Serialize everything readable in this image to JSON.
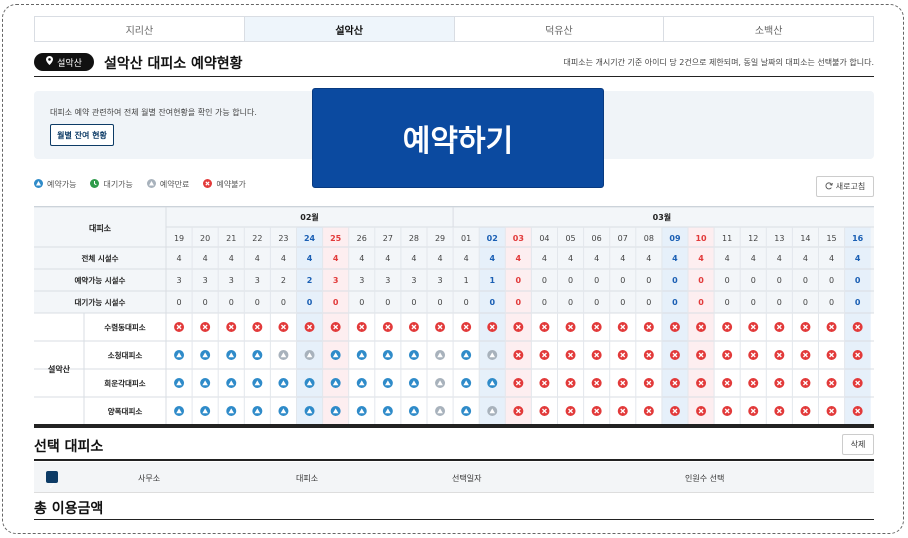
{
  "tabs": [
    {
      "label": "지리산",
      "active": false
    },
    {
      "label": "설악산",
      "active": true
    },
    {
      "label": "덕유산",
      "active": false
    },
    {
      "label": "소백산",
      "active": false
    }
  ],
  "header": {
    "region_pill": "설악산",
    "title": "설악산 대피소 예약현황",
    "note": "대피소는 개시기간 기준 아이디 당 2건으로 제한되며, 동일 날짜의 대피소는 선택불가 합니다."
  },
  "info": {
    "text": "대피소 예약 관련하여 전체 월별 잔여현황을 확인 가능 합니다.",
    "monthly_button": "월별 잔여 현황",
    "reserve_button": "예약하기"
  },
  "legend": [
    {
      "label": "예약가능",
      "status": "available"
    },
    {
      "label": "대기가능",
      "status": "waitlist"
    },
    {
      "label": "예약만료",
      "status": "expired"
    },
    {
      "label": "예약불가",
      "status": "unavailable"
    }
  ],
  "refresh_button": "새로고침",
  "colors": {
    "available": "#2f8bc9",
    "waitlist": "#2e9b4a",
    "expired": "#a8b2bc",
    "unavailable": "#e23a3a",
    "highlight_blue": "#1a5fb4",
    "highlight_red": "#e23a3a"
  },
  "table": {
    "corner_label": "대피소",
    "months": [
      {
        "label": "02월",
        "span": 11
      },
      {
        "label": "03월",
        "span": 16
      }
    ],
    "days": [
      "19",
      "20",
      "21",
      "22",
      "23",
      "24",
      "25",
      "26",
      "27",
      "28",
      "29",
      "01",
      "02",
      "03",
      "04",
      "05",
      "06",
      "07",
      "08",
      "09",
      "10",
      "11",
      "12",
      "13",
      "14",
      "15",
      "16"
    ],
    "day_types": [
      "n",
      "n",
      "n",
      "n",
      "n",
      "sat",
      "sun",
      "n",
      "n",
      "n",
      "n",
      "n",
      "sat",
      "sun",
      "n",
      "n",
      "n",
      "n",
      "n",
      "sat",
      "sun",
      "n",
      "n",
      "n",
      "n",
      "n",
      "sat"
    ],
    "summary_rows": [
      {
        "label": "전체 시설수",
        "values": [
          "4",
          "4",
          "4",
          "4",
          "4",
          "4",
          "4",
          "4",
          "4",
          "4",
          "4",
          "4",
          "4",
          "4",
          "4",
          "4",
          "4",
          "4",
          "4",
          "4",
          "4",
          "4",
          "4",
          "4",
          "4",
          "4",
          "4"
        ]
      },
      {
        "label": "예약가능 시설수",
        "values": [
          "3",
          "3",
          "3",
          "3",
          "2",
          "2",
          "3",
          "3",
          "3",
          "3",
          "3",
          "1",
          "1",
          "0",
          "0",
          "0",
          "0",
          "0",
          "0",
          "0",
          "0",
          "0",
          "0",
          "0",
          "0",
          "0",
          "0"
        ]
      },
      {
        "label": "대기가능 시설수",
        "values": [
          "0",
          "0",
          "0",
          "0",
          "0",
          "0",
          "0",
          "0",
          "0",
          "0",
          "0",
          "0",
          "0",
          "0",
          "0",
          "0",
          "0",
          "0",
          "0",
          "0",
          "0",
          "0",
          "0",
          "0",
          "0",
          "0",
          "0"
        ]
      }
    ],
    "group_label": "설악산",
    "shelters": [
      {
        "name": "수렴동대피소",
        "statuses": [
          "x",
          "x",
          "x",
          "x",
          "x",
          "x",
          "x",
          "x",
          "x",
          "x",
          "x",
          "x",
          "x",
          "x",
          "x",
          "x",
          "x",
          "x",
          "x",
          "x",
          "x",
          "x",
          "x",
          "x",
          "x",
          "x",
          "x"
        ]
      },
      {
        "name": "소청대피소",
        "statuses": [
          "a",
          "a",
          "a",
          "a",
          "e",
          "e",
          "a",
          "a",
          "a",
          "a",
          "e",
          "a",
          "e",
          "x",
          "x",
          "x",
          "x",
          "x",
          "x",
          "x",
          "x",
          "x",
          "x",
          "x",
          "x",
          "x",
          "x"
        ]
      },
      {
        "name": "희운각대피소",
        "statuses": [
          "a",
          "a",
          "a",
          "a",
          "a",
          "a",
          "a",
          "a",
          "a",
          "a",
          "e",
          "a",
          "a",
          "x",
          "x",
          "x",
          "x",
          "x",
          "x",
          "x",
          "x",
          "x",
          "x",
          "x",
          "x",
          "x",
          "x"
        ]
      },
      {
        "name": "양폭대피소",
        "statuses": [
          "a",
          "a",
          "a",
          "a",
          "a",
          "a",
          "a",
          "a",
          "a",
          "a",
          "e",
          "a",
          "e",
          "x",
          "x",
          "x",
          "x",
          "x",
          "x",
          "x",
          "x",
          "x",
          "x",
          "x",
          "x",
          "x",
          "x"
        ]
      }
    ]
  },
  "selection": {
    "title": "선택 대피소",
    "delete_button": "삭제",
    "columns": [
      "사무소",
      "대피소",
      "선택일자",
      "인원수 선택"
    ]
  },
  "total": {
    "title": "총 이용금액"
  }
}
